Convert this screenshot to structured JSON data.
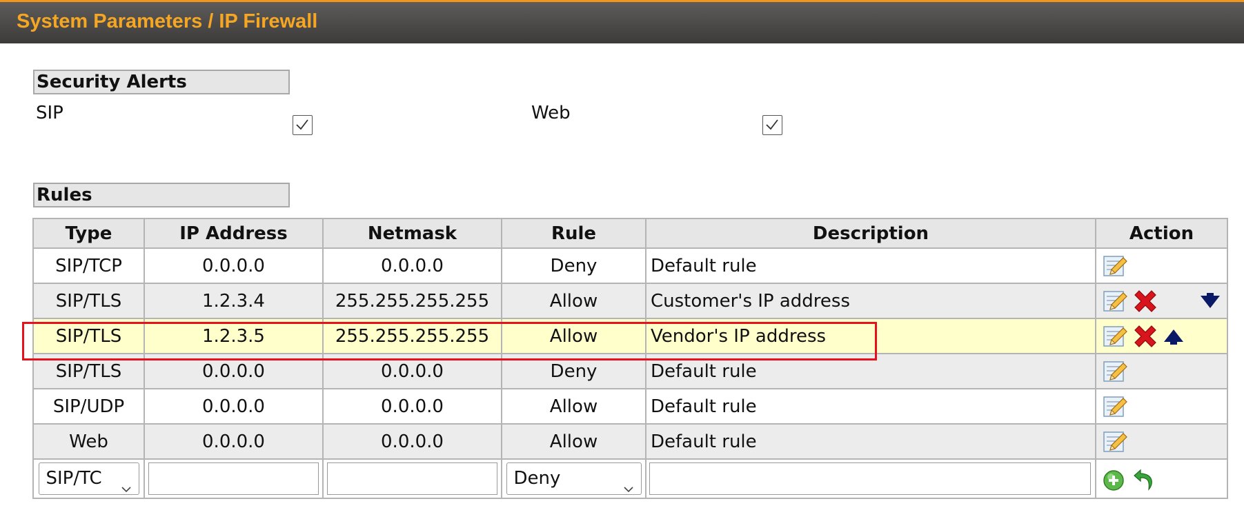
{
  "header": {
    "title": "System Parameters / IP Firewall"
  },
  "security_alerts": {
    "label": "Security Alerts",
    "sip_label": "SIP",
    "web_label": "Web",
    "sip_checked": true,
    "web_checked": true
  },
  "rules": {
    "label": "Rules",
    "columns": [
      "Type",
      "IP Address",
      "Netmask",
      "Rule",
      "Description",
      "Action"
    ],
    "rows": [
      {
        "type": "SIP/TCP",
        "ip": "0.0.0.0",
        "netmask": "0.0.0.0",
        "rule": "Deny",
        "description": "Default rule"
      },
      {
        "type": "SIP/TLS",
        "ip": "1.2.3.4",
        "netmask": "255.255.255.255",
        "rule": "Allow",
        "description": "Customer's IP address"
      },
      {
        "type": "SIP/TLS",
        "ip": "1.2.3.5",
        "netmask": "255.255.255.255",
        "rule": "Allow",
        "description": "Vendor's IP address"
      },
      {
        "type": "SIP/TLS",
        "ip": "0.0.0.0",
        "netmask": "0.0.0.0",
        "rule": "Deny",
        "description": "Default rule"
      },
      {
        "type": "SIP/UDP",
        "ip": "0.0.0.0",
        "netmask": "0.0.0.0",
        "rule": "Allow",
        "description": "Default rule"
      },
      {
        "type": "Web",
        "ip": "0.0.0.0",
        "netmask": "0.0.0.0",
        "rule": "Allow",
        "description": "Default rule"
      }
    ],
    "new_row": {
      "type_value": "SIP/TC",
      "rule_value": "Deny",
      "ip_value": "",
      "netmask_value": "",
      "description_value": ""
    }
  },
  "icons": {
    "edit": "edit-icon",
    "delete": "delete-icon",
    "move_up": "arrow-up-icon",
    "move_down": "arrow-down-icon",
    "add": "add-icon",
    "undo": "undo-icon"
  },
  "colors": {
    "header_title": "#f5a623",
    "accent_line": "#f2951c",
    "highlight_row": "#ffffcc",
    "selection_border": "#e8101a"
  }
}
